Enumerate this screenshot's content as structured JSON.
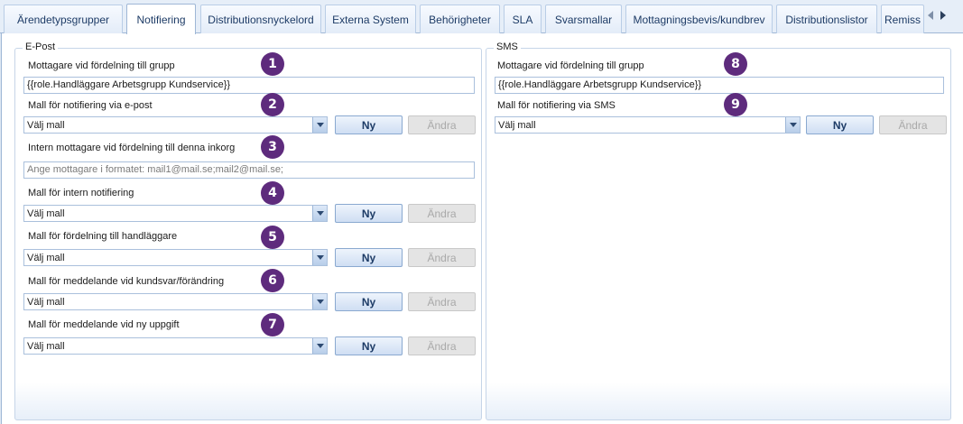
{
  "tabs": [
    {
      "label": "Ärendetypsgrupper"
    },
    {
      "label": "Notifiering"
    },
    {
      "label": "Distributionsnyckelord"
    },
    {
      "label": "Externa System"
    },
    {
      "label": "Behörigheter"
    },
    {
      "label": "SLA"
    },
    {
      "label": "Svarsmallar"
    },
    {
      "label": "Mottagningsbevis/kundbrev"
    },
    {
      "label": "Distributionslistor"
    },
    {
      "label": "Remiss"
    }
  ],
  "active_tab": "Notifiering",
  "buttons": {
    "new": "Ny",
    "edit": "Ändra"
  },
  "email": {
    "title": "E-Post",
    "group_recipient_label": "Mottagare vid fördelning till grupp",
    "group_recipient_value": "{{role.Handläggare Arbetsgrupp Kundservice}}",
    "email_template_label": "Mall för notifiering via e-post",
    "email_template_value": "Välj mall",
    "internal_recipient_label": "Intern mottagare vid fördelning till denna inkorg",
    "internal_recipient_placeholder": "Ange mottagare i formatet: mail1@mail.se;mail2@mail.se;",
    "internal_template_label": "Mall för intern notifiering",
    "internal_template_value": "Välj mall",
    "handler_template_label": "Mall för fördelning till handläggare",
    "handler_template_value": "Välj mall",
    "customer_reply_template_label": "Mall för meddelande vid kundsvar/förändring",
    "customer_reply_template_value": "Välj mall",
    "new_task_template_label": "Mall för meddelande vid ny uppgift",
    "new_task_template_value": "Välj mall"
  },
  "sms": {
    "title": "SMS",
    "group_recipient_label": "Mottagare vid fördelning till grupp",
    "group_recipient_value": "{{role.Handläggare Arbetsgrupp Kundservice}}",
    "sms_template_label": "Mall för notifiering via SMS",
    "sms_template_value": "Välj mall"
  },
  "markers": [
    "1",
    "2",
    "3",
    "4",
    "5",
    "6",
    "7",
    "8",
    "9"
  ]
}
